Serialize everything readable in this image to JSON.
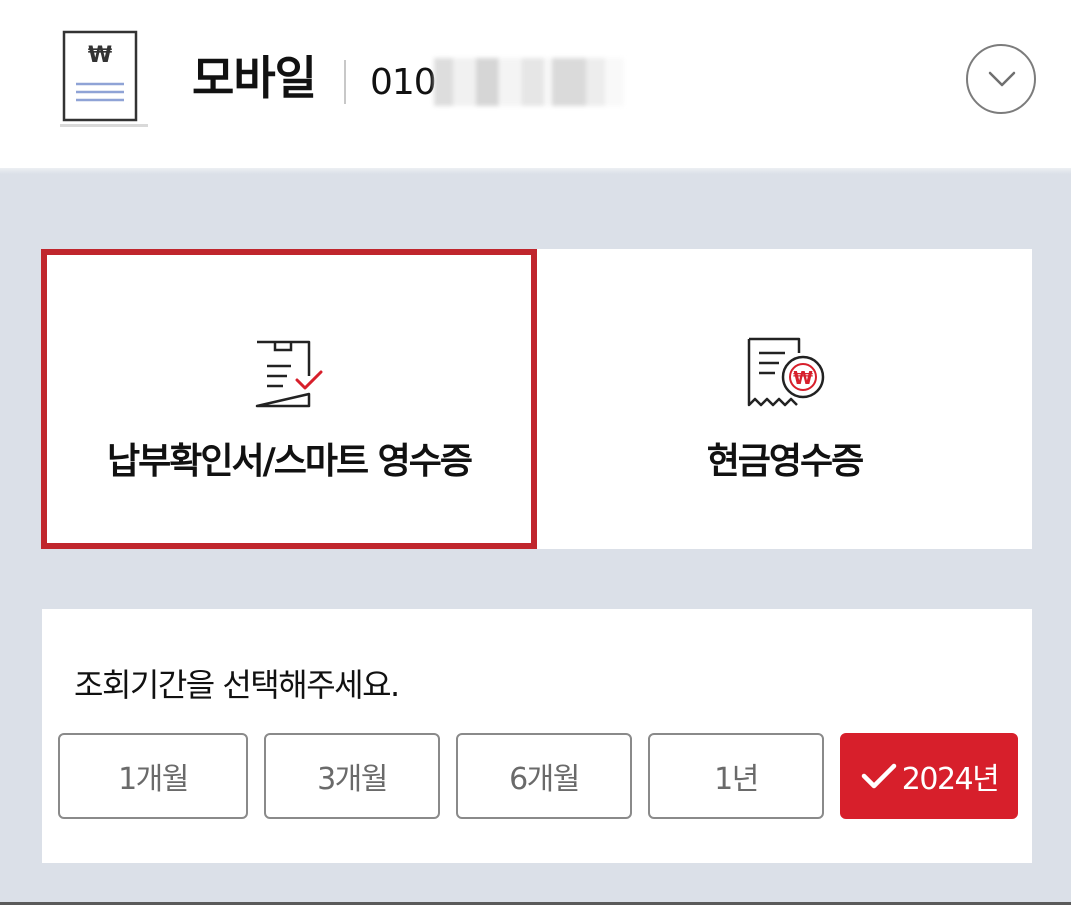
{
  "header": {
    "service_title": "모바일",
    "phone_prefix": "010",
    "icons": {
      "bill": "won-bill-icon",
      "toggle": "chevron-down-icon"
    }
  },
  "cards": [
    {
      "label": "납부확인서/스마트 영수증",
      "icon": "clipboard-check-icon",
      "selected": true
    },
    {
      "label": "현금영수증",
      "icon": "cash-receipt-won-icon",
      "selected": false
    }
  ],
  "period": {
    "prompt": "조회기간을 선택해주세요.",
    "options": [
      "1개월",
      "3개월",
      "6개월",
      "1년",
      "2024년"
    ],
    "selected": "2024년"
  },
  "colors": {
    "accent_red": "#d71f2b",
    "selected_border": "#c0262d",
    "background": "#dbe0e8"
  }
}
